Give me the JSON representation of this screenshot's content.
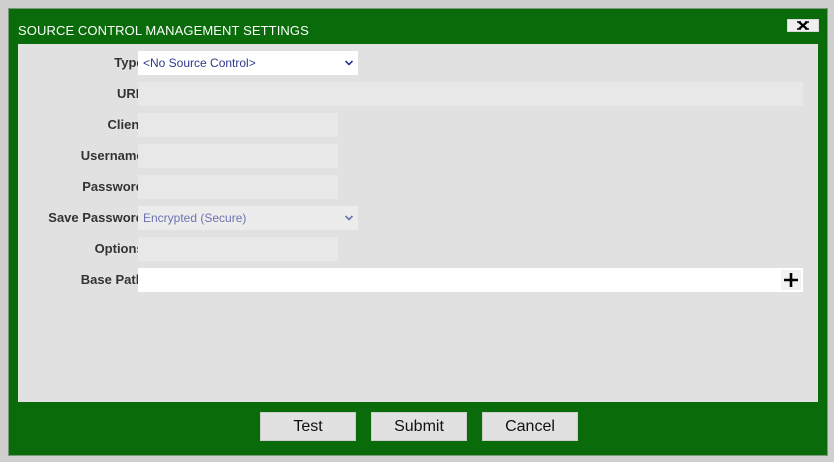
{
  "dialog": {
    "title": "SOURCE CONTROL MANAGEMENT SETTINGS",
    "close_icon": "close-x-icon"
  },
  "form": {
    "type": {
      "label": "Type:",
      "value": "<No Source Control>"
    },
    "url": {
      "label": "URL:",
      "value": ""
    },
    "client": {
      "label": "Client:",
      "value": ""
    },
    "username": {
      "label": "Username:",
      "value": ""
    },
    "password": {
      "label": "Password:",
      "value": ""
    },
    "save_password": {
      "label": "Save Password:",
      "value": "Encrypted (Secure)"
    },
    "options": {
      "label": "Options:",
      "value": ""
    },
    "base_path": {
      "label": "Base Path:",
      "value": "",
      "add_icon": "plus-icon"
    }
  },
  "buttons": {
    "test": "Test",
    "submit": "Submit",
    "cancel": "Cancel"
  },
  "colors": {
    "frame": "#0a6b0a",
    "panel": "#e1e1e1",
    "select_text": "#2e3a8c"
  }
}
